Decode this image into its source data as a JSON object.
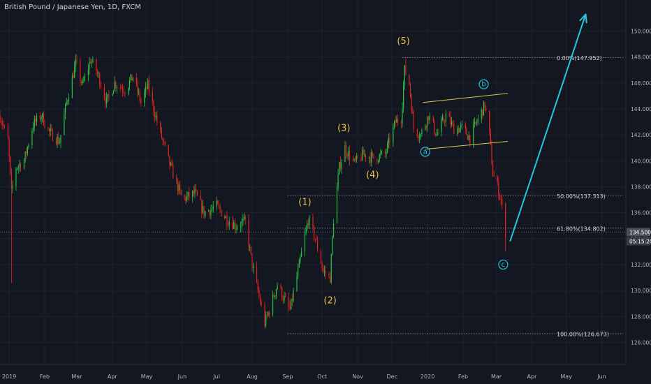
{
  "header": {
    "title": "British Pound / Japanese Yen, 1D, FXCM"
  },
  "colors": {
    "background": "#131722",
    "bull": "#26c640",
    "bear": "#e8231e",
    "grid": "#1e222d",
    "axis_text": "#b2b5be",
    "wave_label": "#f0c23c",
    "abc_label": "#26c6da",
    "arrow": "#26c6da",
    "channel": "#d8c84a",
    "fib_line": "#9598a1",
    "price_tag": "#363a45"
  },
  "chart_data": {
    "type": "candlestick",
    "title": "British Pound / Japanese Yen, 1D, FXCM",
    "ylim": [
      124.3,
      152.4
    ],
    "yticks": [
      126,
      128,
      130,
      132,
      134,
      136,
      138,
      140,
      142,
      144,
      146,
      148,
      150
    ],
    "ytick_labels": [
      "126.000",
      "128.000",
      "130.000",
      "132.000",
      "134.000",
      "136.000",
      "138.000",
      "140.000",
      "142.000",
      "144.000",
      "146.000",
      "148.000",
      "150.000"
    ],
    "xlim": [
      "2018-12-24",
      "2020-06-22"
    ],
    "xticks": [
      {
        "date": "2019-01-01",
        "label": "2019"
      },
      {
        "date": "2019-02-01",
        "label": "Feb"
      },
      {
        "date": "2019-03-01",
        "label": "Mar"
      },
      {
        "date": "2019-04-01",
        "label": "Apr"
      },
      {
        "date": "2019-05-01",
        "label": "May"
      },
      {
        "date": "2019-06-01",
        "label": "Jun"
      },
      {
        "date": "2019-07-01",
        "label": "Jul"
      },
      {
        "date": "2019-08-01",
        "label": "Aug"
      },
      {
        "date": "2019-09-01",
        "label": "Sep"
      },
      {
        "date": "2019-10-01",
        "label": "Oct"
      },
      {
        "date": "2019-11-01",
        "label": "Nov"
      },
      {
        "date": "2019-12-01",
        "label": "Dec"
      },
      {
        "date": "2020-01-01",
        "label": "2020"
      },
      {
        "date": "2020-02-01",
        "label": "Feb"
      },
      {
        "date": "2020-03-01",
        "label": "Mar"
      },
      {
        "date": "2020-04-01",
        "label": "Apr"
      },
      {
        "date": "2020-05-01",
        "label": "May"
      },
      {
        "date": "2020-06-01",
        "label": "Jun"
      }
    ],
    "price_path": [
      {
        "date": "2018-12-24",
        "price": 143.5
      },
      {
        "date": "2018-12-31",
        "price": 141.5
      },
      {
        "date": "2019-01-03",
        "price": 137.5
      },
      {
        "date": "2019-01-07",
        "price": 139.5
      },
      {
        "date": "2019-01-14",
        "price": 140.0
      },
      {
        "date": "2019-01-22",
        "price": 142.8
      },
      {
        "date": "2019-01-29",
        "price": 143.5
      },
      {
        "date": "2019-02-05",
        "price": 142.2
      },
      {
        "date": "2019-02-14",
        "price": 141.5
      },
      {
        "date": "2019-02-20",
        "price": 144.5
      },
      {
        "date": "2019-02-28",
        "price": 147.5
      },
      {
        "date": "2019-03-06",
        "price": 145.8
      },
      {
        "date": "2019-03-13",
        "price": 147.8
      },
      {
        "date": "2019-03-20",
        "price": 146.5
      },
      {
        "date": "2019-03-27",
        "price": 144.5
      },
      {
        "date": "2019-04-03",
        "price": 146.0
      },
      {
        "date": "2019-04-12",
        "price": 145.5
      },
      {
        "date": "2019-04-19",
        "price": 146.5
      },
      {
        "date": "2019-04-26",
        "price": 144.5
      },
      {
        "date": "2019-05-02",
        "price": 145.8
      },
      {
        "date": "2019-05-10",
        "price": 143.0
      },
      {
        "date": "2019-05-20",
        "price": 140.0
      },
      {
        "date": "2019-06-01",
        "price": 137.0
      },
      {
        "date": "2019-06-12",
        "price": 137.5
      },
      {
        "date": "2019-06-20",
        "price": 136.0
      },
      {
        "date": "2019-07-01",
        "price": 136.5
      },
      {
        "date": "2019-07-10",
        "price": 135.5
      },
      {
        "date": "2019-07-18",
        "price": 135.0
      },
      {
        "date": "2019-07-26",
        "price": 135.3
      },
      {
        "date": "2019-08-01",
        "price": 132.0
      },
      {
        "date": "2019-08-07",
        "price": 129.5
      },
      {
        "date": "2019-08-12",
        "price": 127.5
      },
      {
        "date": "2019-08-16",
        "price": 128.5
      },
      {
        "date": "2019-08-23",
        "price": 130.5
      },
      {
        "date": "2019-08-28",
        "price": 129.5
      },
      {
        "date": "2019-09-03",
        "price": 128.5
      },
      {
        "date": "2019-09-10",
        "price": 131.5
      },
      {
        "date": "2019-09-19",
        "price": 135.5
      },
      {
        "date": "2019-09-25",
        "price": 134.0
      },
      {
        "date": "2019-10-02",
        "price": 131.5
      },
      {
        "date": "2019-10-08",
        "price": 131.0
      },
      {
        "date": "2019-10-11",
        "price": 135.5
      },
      {
        "date": "2019-10-16",
        "price": 139.5
      },
      {
        "date": "2019-10-21",
        "price": 141.0
      },
      {
        "date": "2019-10-29",
        "price": 139.8
      },
      {
        "date": "2019-11-06",
        "price": 140.5
      },
      {
        "date": "2019-11-15",
        "price": 140.2
      },
      {
        "date": "2019-11-25",
        "price": 140.5
      },
      {
        "date": "2019-12-04",
        "price": 143.0
      },
      {
        "date": "2019-12-09",
        "price": 143.3
      },
      {
        "date": "2019-12-12",
        "price": 147.0
      },
      {
        "date": "2019-12-16",
        "price": 146.0
      },
      {
        "date": "2019-12-20",
        "price": 142.5
      },
      {
        "date": "2019-12-26",
        "price": 142.0
      },
      {
        "date": "2020-01-02",
        "price": 143.5
      },
      {
        "date": "2020-01-09",
        "price": 142.0
      },
      {
        "date": "2020-01-17",
        "price": 143.5
      },
      {
        "date": "2020-01-24",
        "price": 142.5
      },
      {
        "date": "2020-01-31",
        "price": 142.5
      },
      {
        "date": "2020-02-07",
        "price": 141.8
      },
      {
        "date": "2020-02-13",
        "price": 143.0
      },
      {
        "date": "2020-02-20",
        "price": 144.3
      },
      {
        "date": "2020-02-24",
        "price": 142.0
      },
      {
        "date": "2020-02-27",
        "price": 139.0
      },
      {
        "date": "2020-03-02",
        "price": 138.0
      },
      {
        "date": "2020-03-05",
        "price": 137.0
      },
      {
        "date": "2020-03-09",
        "price": 134.5
      }
    ],
    "extremes": [
      {
        "date": "2019-01-03",
        "low": 130.6
      },
      {
        "date": "2019-12-13",
        "high": 147.95
      },
      {
        "date": "2020-03-09",
        "low": 133.0
      }
    ],
    "current_price": 134.5,
    "price_tags": [
      {
        "price": 134.5,
        "label": "134.500"
      },
      {
        "price": 133.8,
        "label": "05:15:20"
      }
    ],
    "fib_levels": [
      {
        "price": 147.952,
        "label": "0.00%(147.952)",
        "start": "2019-12-10"
      },
      {
        "price": 137.313,
        "label": "50.00%(137.313)",
        "start": "2019-09-01"
      },
      {
        "price": 134.802,
        "label": "61.80%(134.802)",
        "start": "2019-09-01"
      },
      {
        "price": 126.673,
        "label": "100.00%(126.673)",
        "start": "2019-09-01"
      }
    ],
    "wave_labels": [
      {
        "text": "(1)",
        "date": "2019-09-16",
        "price": 136.8
      },
      {
        "text": "(2)",
        "date": "2019-10-08",
        "price": 129.2
      },
      {
        "text": "(3)",
        "date": "2019-10-20",
        "price": 142.5
      },
      {
        "text": "(4)",
        "date": "2019-11-14",
        "price": 138.9
      },
      {
        "text": "(5)",
        "date": "2019-12-11",
        "price": 149.2
      }
    ],
    "abc_labels": [
      {
        "text": "a",
        "date": "2019-12-30",
        "price": 140.7
      },
      {
        "text": "b",
        "date": "2020-02-19",
        "price": 145.9
      },
      {
        "text": "c",
        "date": "2020-03-07",
        "price": 132.0
      }
    ],
    "channel": {
      "upper": [
        {
          "date": "2019-12-28",
          "price": 144.5
        },
        {
          "date": "2020-03-11",
          "price": 145.2
        }
      ],
      "lower": [
        {
          "date": "2019-12-30",
          "price": 140.9
        },
        {
          "date": "2020-03-11",
          "price": 141.5
        }
      ]
    },
    "projection_arrow": [
      {
        "date": "2020-03-13",
        "price": 133.8
      },
      {
        "date": "2020-05-18",
        "price": 151.3
      }
    ]
  }
}
